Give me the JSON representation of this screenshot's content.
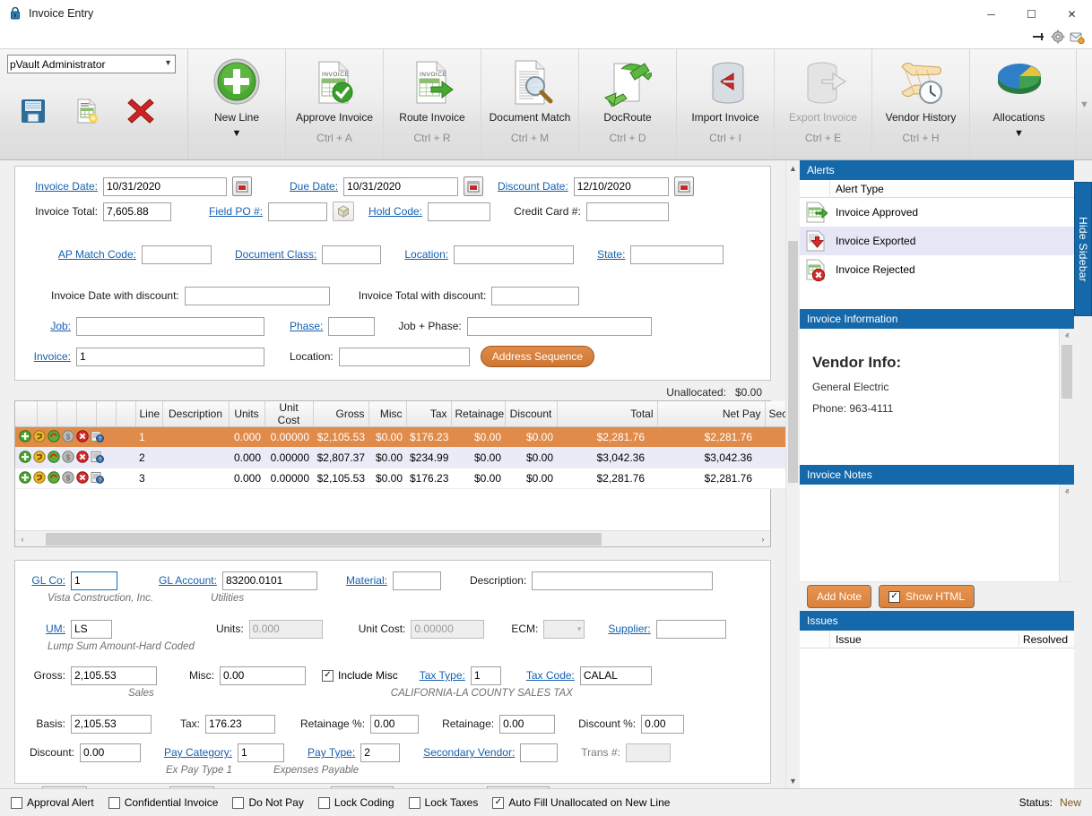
{
  "window": {
    "title": "Invoice Entry",
    "lock_icon": "lock-icon",
    "minimize": "─",
    "maximize": "☐",
    "close": "✕",
    "quick_icons": [
      "pin-icon",
      "gear-icon",
      "mail-help-icon"
    ]
  },
  "ribbon": {
    "user_select": {
      "value": "pVault Administrator",
      "options": [
        "pVault Administrator"
      ]
    },
    "small_buttons": [
      {
        "name": "save-button",
        "icon": "floppy-disk-icon"
      },
      {
        "name": "new-invoice-button",
        "icon": "invoice-new-icon"
      },
      {
        "name": "delete-button",
        "icon": "red-x-icon"
      }
    ],
    "items": [
      {
        "label": "New Line",
        "key": "",
        "icon": "green-plus-circle-icon",
        "dropdown": "▼",
        "disabled": false
      },
      {
        "label": "Approve Invoice",
        "key": "Ctrl + A",
        "icon": "invoice-check-icon",
        "dropdown": "",
        "disabled": false
      },
      {
        "label": "Route Invoice",
        "key": "Ctrl + R",
        "icon": "invoice-arrow-icon",
        "dropdown": "",
        "disabled": false
      },
      {
        "label": "Document Match",
        "key": "Ctrl + M",
        "icon": "document-magnifier-icon",
        "dropdown": "",
        "disabled": false
      },
      {
        "label": "DocRoute",
        "key": "Ctrl + D",
        "icon": "document-recycle-icon",
        "dropdown": "",
        "disabled": false
      },
      {
        "label": "Import Invoice",
        "key": "Ctrl + I",
        "icon": "database-import-icon",
        "dropdown": "",
        "disabled": false
      },
      {
        "label": "Export Invoice",
        "key": "Ctrl + E",
        "icon": "database-export-icon",
        "dropdown": "",
        "disabled": true
      },
      {
        "label": "Vendor History",
        "key": "Ctrl + H",
        "icon": "scroll-clock-icon",
        "dropdown": "",
        "disabled": false
      },
      {
        "label": "Allocations",
        "key": "",
        "icon": "pie-chart-icon",
        "dropdown": "▼",
        "disabled": false
      }
    ],
    "scroll_arrow": "▼"
  },
  "header_form": {
    "invoice_date_label": "Invoice Date:",
    "invoice_date_value": "10/31/2020",
    "due_date_label": "Due Date:",
    "due_date_value": "10/31/2020",
    "discount_date_label": "Discount Date:",
    "discount_date_value": "12/10/2020",
    "invoice_total_label": "Invoice Total:",
    "invoice_total_value": "7,605.88",
    "field_po_label": "Field PO #:",
    "field_po_value": "",
    "hold_code_label": "Hold Code:",
    "hold_code_value": "",
    "credit_card_label": "Credit Card #:",
    "credit_card_value": "",
    "ap_match_label": "AP Match Code:",
    "ap_match_value": "",
    "document_class_label": "Document Class:",
    "document_class_value": "",
    "location_label": "Location:",
    "location_value": "",
    "state_label": "State:",
    "state_value": "",
    "invoice_date_discount_label": "Invoice Date with discount:",
    "invoice_date_discount_value": "",
    "invoice_total_discount_label": "Invoice Total with discount:",
    "invoice_total_discount_value": "",
    "job_label": "Job:",
    "job_value": "",
    "phase_label": "Phase:",
    "phase_value": "",
    "job_phase_label": "Job + Phase:",
    "job_phase_value": "",
    "invoice_label": "Invoice:",
    "invoice_value": "1",
    "location2_label": "Location:",
    "location2_value": "",
    "address_sequence_button": "Address Sequence",
    "calendar_icon": "calendar-icon",
    "cube_icon": "cube-icon"
  },
  "grid": {
    "unallocated_label": "Unallocated:",
    "unallocated_value": "$0.00",
    "row_icons": [
      "green-plus-icon",
      "yellow-arrow-icon",
      "recycle-icon",
      "dollar-icon",
      "red-x-icon",
      "report-question-icon"
    ],
    "columns": [
      "Line",
      "Description",
      "Units",
      "Unit Cost",
      "Gross",
      "Misc",
      "Tax",
      "Retainage",
      "Discount",
      "Total",
      "Net Pay",
      "Secondar"
    ],
    "rows": [
      {
        "line": "1",
        "description": "",
        "units": "0.000",
        "unit_cost": "0.00000",
        "gross": "$2,105.53",
        "misc": "$0.00",
        "tax": "$176.23",
        "retainage": "$0.00",
        "discount": "$0.00",
        "total": "$2,281.76",
        "net_pay": "$2,281.76",
        "secondary": "",
        "selected": true
      },
      {
        "line": "2",
        "description": "",
        "units": "0.000",
        "unit_cost": "0.00000",
        "gross": "$2,807.37",
        "misc": "$0.00",
        "tax": "$234.99",
        "retainage": "$0.00",
        "discount": "$0.00",
        "total": "$3,042.36",
        "net_pay": "$3,042.36",
        "secondary": "",
        "selected": false
      },
      {
        "line": "3",
        "description": "",
        "units": "0.000",
        "unit_cost": "0.00000",
        "gross": "$2,105.53",
        "misc": "$0.00",
        "tax": "$176.23",
        "retainage": "$0.00",
        "discount": "$0.00",
        "total": "$2,281.76",
        "net_pay": "$2,281.76",
        "secondary": "",
        "selected": false
      }
    ],
    "scroll_left": "‹",
    "scroll_right": "›"
  },
  "detail": {
    "gl_co_label": "GL Co:",
    "gl_co_value": "1",
    "gl_co_hint": "Vista Construction, Inc.",
    "gl_account_label": "GL Account:",
    "gl_account_value": "83200.0101",
    "gl_account_hint": "Utilities",
    "material_label": "Material:",
    "material_value": "",
    "description_label": "Description:",
    "description_value": "",
    "um_label": "UM:",
    "um_value": "LS",
    "um_hint": "Lump Sum Amount-Hard Coded",
    "units_label": "Units:",
    "units_value": "0.000",
    "unit_cost_label": "Unit Cost:",
    "unit_cost_value": "0.00000",
    "ecm_label": "ECM:",
    "ecm_value": "",
    "supplier_label": "Supplier:",
    "supplier_value": "",
    "gross_label": "Gross:",
    "gross_value": "2,105.53",
    "misc_label": "Misc:",
    "misc_value": "0.00",
    "include_misc_label": "Include Misc",
    "include_misc_checked": true,
    "tax_type_label": "Tax Type:",
    "tax_type_value": "1",
    "tax_type_hint": "Sales",
    "tax_code_label": "Tax Code:",
    "tax_code_value": "CALAL",
    "tax_code_hint": "CALIFORNIA-LA COUNTY SALES TAX",
    "basis_label": "Basis:",
    "basis_value": "2,105.53",
    "tax_label": "Tax:",
    "tax_value": "176.23",
    "retainage_pct_label": "Retainage %:",
    "retainage_pct_value": "0.00",
    "retainage_label": "Retainage:",
    "retainage_value": "0.00",
    "discount_pct_label": "Discount %:",
    "discount_pct_value": "0.00",
    "discount_label": "Discount:",
    "discount_value": "0.00",
    "pay_category_label": "Pay Category:",
    "pay_category_value": "1",
    "pay_category_hint": "Ex Pay Type 1",
    "pay_type_label": "Pay Type:",
    "pay_type_value": "2",
    "pay_type_hint": "Expenses Payable",
    "secondary_vendor_label": "Secondary Vendor:",
    "secondary_vendor_value": "",
    "trans_label": "Trans #:",
    "trans_value": ""
  },
  "sidebar": {
    "alerts": {
      "title": "Alerts",
      "column_header": "Alert Type",
      "items": [
        {
          "label": "Invoice Approved",
          "icon": "invoice-approved-icon",
          "selected": false
        },
        {
          "label": "Invoice Exported",
          "icon": "invoice-exported-icon",
          "selected": true
        },
        {
          "label": "Invoice Rejected",
          "icon": "invoice-rejected-icon",
          "selected": false
        }
      ]
    },
    "invoice_information": {
      "title": "Invoice Information",
      "vendor_heading": "Vendor Info:",
      "vendor_name": "General Electric",
      "vendor_phone": "Phone: 963-4111"
    },
    "invoice_notes": {
      "title": "Invoice Notes",
      "add_note_button": "Add Note",
      "show_html_label": "Show HTML",
      "show_html_checked": true
    },
    "issues": {
      "title": "Issues",
      "columns": [
        "Issue",
        "Resolved"
      ]
    },
    "hide_sidebar_label": "Hide Sidebar",
    "scroll_up": "ⱏ",
    "scroll_down": "ⱟ"
  },
  "statusbar": {
    "checkboxes": [
      {
        "label": "Approval Alert",
        "checked": false
      },
      {
        "label": "Confidential Invoice",
        "checked": false
      },
      {
        "label": "Do Not Pay",
        "checked": false
      },
      {
        "label": "Lock Coding",
        "checked": false
      },
      {
        "label": "Lock Taxes",
        "checked": false
      },
      {
        "label": "Auto Fill Unallocated on New Line",
        "checked": true
      }
    ],
    "status_label": "Status:",
    "status_value": "New"
  },
  "colors": {
    "accent_blue": "#1569ab",
    "link_blue": "#1560b0",
    "selected_row": "#e08b4a",
    "alt_row": "#ebebf7"
  }
}
